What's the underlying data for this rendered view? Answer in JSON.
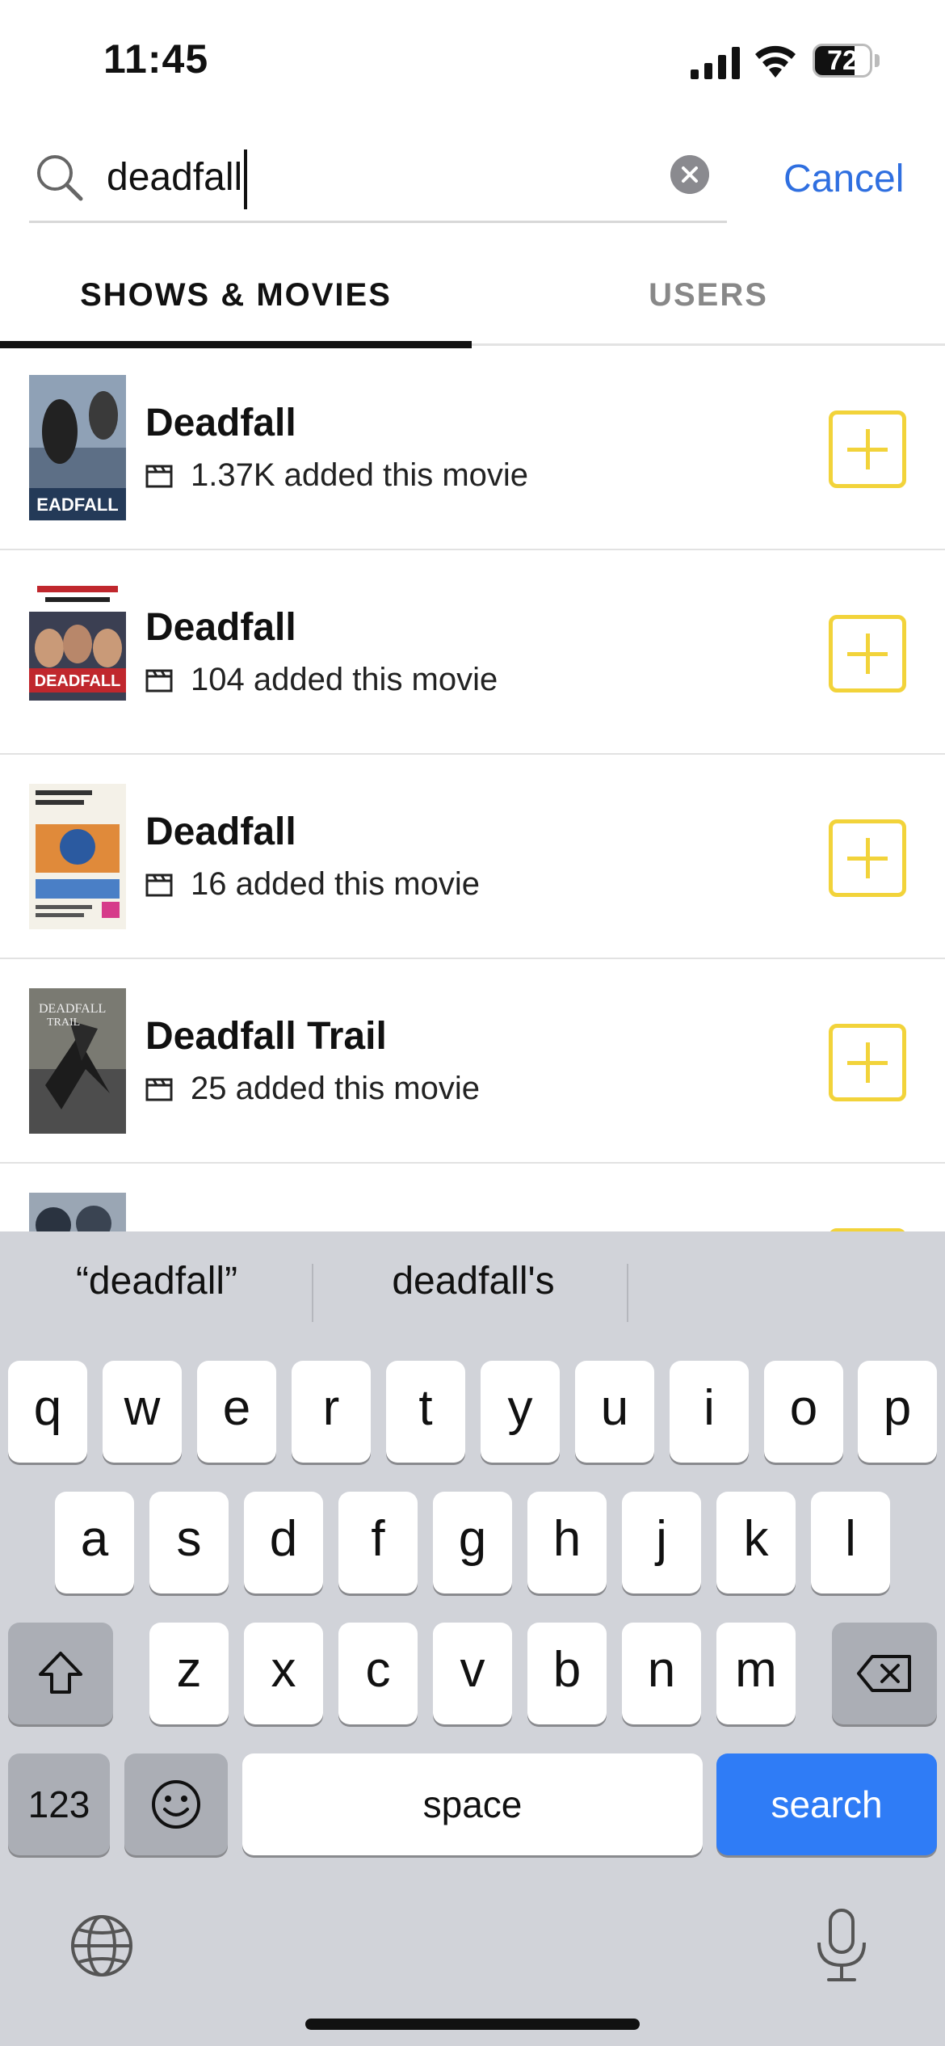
{
  "status_bar": {
    "time": "11:45",
    "battery": "72",
    "battery_level": 0.72
  },
  "search": {
    "query": "deadfall",
    "cancel_label": "Cancel"
  },
  "tabs": [
    {
      "label": "SHOWS & MOVIES",
      "active": true
    },
    {
      "label": "USERS",
      "active": false
    }
  ],
  "results": [
    {
      "title": "Deadfall",
      "meta": "1.37K added this movie"
    },
    {
      "title": "Deadfall",
      "meta": "104 added this movie"
    },
    {
      "title": "Deadfall",
      "meta": "16 added this movie"
    },
    {
      "title": "Deadfall Trail",
      "meta": "25 added this movie"
    }
  ],
  "keyboard": {
    "suggestions": [
      "“deadfall”",
      "deadfall's"
    ],
    "row1": [
      "q",
      "w",
      "e",
      "r",
      "t",
      "y",
      "u",
      "i",
      "o",
      "p"
    ],
    "row2": [
      "a",
      "s",
      "d",
      "f",
      "g",
      "h",
      "j",
      "k",
      "l"
    ],
    "row3": [
      "z",
      "x",
      "c",
      "v",
      "b",
      "n",
      "m"
    ],
    "numbers_label": "123",
    "space_label": "space",
    "search_label": "search"
  },
  "colors": {
    "accent_blue": "#2f6fe0",
    "add_yellow": "#f2d33a",
    "search_key": "#2f7cf6"
  }
}
